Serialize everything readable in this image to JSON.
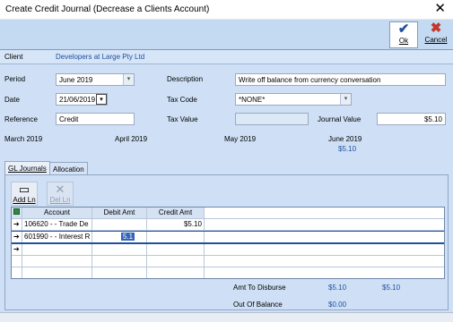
{
  "window": {
    "title": "Create Credit Journal (Decrease a Clients Account)",
    "close_glyph": "✕"
  },
  "toolbar": {
    "ok_label": "Ok",
    "cancel_label": "Cancel",
    "ok_icon": "checkmark-icon",
    "cancel_icon": "x-icon"
  },
  "client": {
    "label": "Client",
    "value": "Developers at Large Pty Ltd"
  },
  "form": {
    "period_label": "Period",
    "period_value": "June 2019",
    "date_label": "Date",
    "date_value": "21/06/2019",
    "reference_label": "Reference",
    "reference_value": "Credit",
    "description_label": "Description",
    "description_value": "Write off balance from currency conversation",
    "taxcode_label": "Tax Code",
    "taxcode_value": "*NONE*",
    "taxvalue_label": "Tax Value",
    "taxvalue_value": "",
    "journalvalue_label": "Journal Value",
    "journalvalue_value": "$5.10"
  },
  "months": [
    "March 2019",
    "April 2019",
    "May 2019",
    "June 2019"
  ],
  "june_amount": "$5.10",
  "tabs": [
    {
      "label": "GL Journals"
    },
    {
      "label": "Allocation"
    }
  ],
  "grid_tools": {
    "add_label": "Add Ln",
    "del_label": "Del Ln"
  },
  "grid": {
    "columns": [
      "Account",
      "Debit Amt",
      "Credit Amt"
    ],
    "rows": [
      {
        "account": "106620 - - Trade De",
        "debit": "",
        "credit": "$5.10"
      },
      {
        "account": "601990 - - Interest R",
        "debit": "5.1",
        "credit": ""
      }
    ]
  },
  "totals": {
    "disburse_label": "Amt To Disburse",
    "disburse_value1": "$5.10",
    "disburse_value2": "$5.10",
    "balance_label": "Out Of Balance",
    "balance_value": "$0.00"
  },
  "colors": {
    "accent": "#1f4f9e",
    "background": "#cfe0f6",
    "cancel": "#c0392b"
  }
}
